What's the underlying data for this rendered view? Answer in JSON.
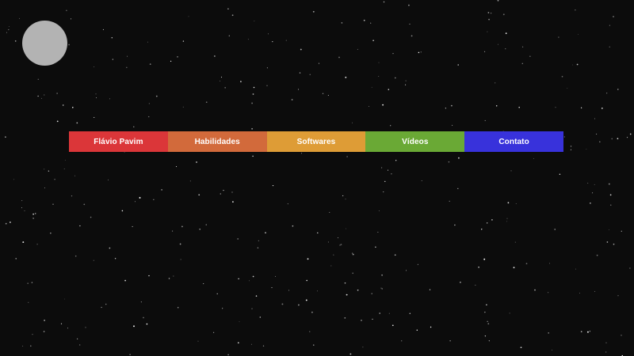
{
  "profile": {
    "avatar_color": "#b3b3b3"
  },
  "nav": {
    "items": [
      {
        "label": "Flávio Pavim",
        "color": "#db3639"
      },
      {
        "label": "Habilidades",
        "color": "#d26a3b"
      },
      {
        "label": "Softwares",
        "color": "#de9c36"
      },
      {
        "label": "Vídeos",
        "color": "#6aa935"
      },
      {
        "label": "Contato",
        "color": "#3832db"
      }
    ]
  },
  "background": {
    "color": "#0c0c0c",
    "star_color": "#ffffff"
  }
}
